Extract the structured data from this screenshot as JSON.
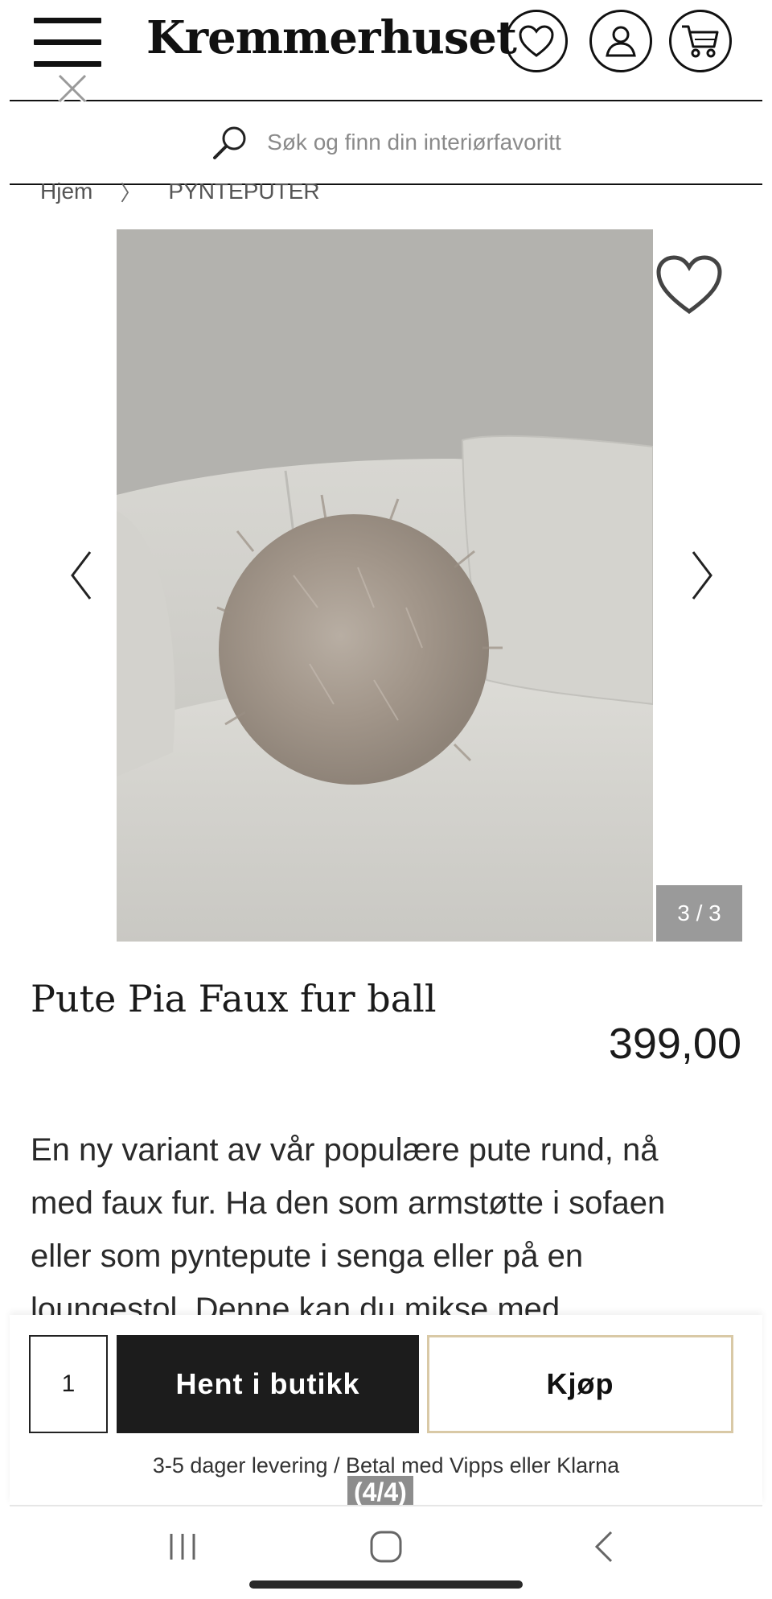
{
  "header": {
    "logo": "Kremmerhuset",
    "icons": [
      "menu-icon",
      "close-icon",
      "heart-icon",
      "user-icon",
      "cart-icon"
    ]
  },
  "search": {
    "placeholder": "Søk og finn din interiørfavoritt"
  },
  "breadcrumb": {
    "items": [
      "Hjem",
      "PYNTEPUTER"
    ],
    "separator": "〉"
  },
  "gallery": {
    "counter": "3 / 3",
    "photo_subject": "Grey faux fur ball cushion on a white boucle sofa"
  },
  "product": {
    "title": "Pute Pia Faux fur ball",
    "price": "399,00",
    "description": "En ny variant av vår populære pute rund, nå med faux fur. Ha den som armstøtte i sofaen eller som pyntepute i senga eller på en loungestol. Denne kan du mikse med"
  },
  "buybar": {
    "quantity": "1",
    "pickup_label": "Hent i butikk",
    "buy_label": "Kjøp",
    "delivery_text": "3-5 dager levering / Betal med Vipps eller Klarna",
    "page_indicator": "(4/4)"
  },
  "colors": {
    "primary_dark": "#1c1c1c",
    "buy_border": "#d9c9a6",
    "counter_bg": "#9a9a9a"
  }
}
